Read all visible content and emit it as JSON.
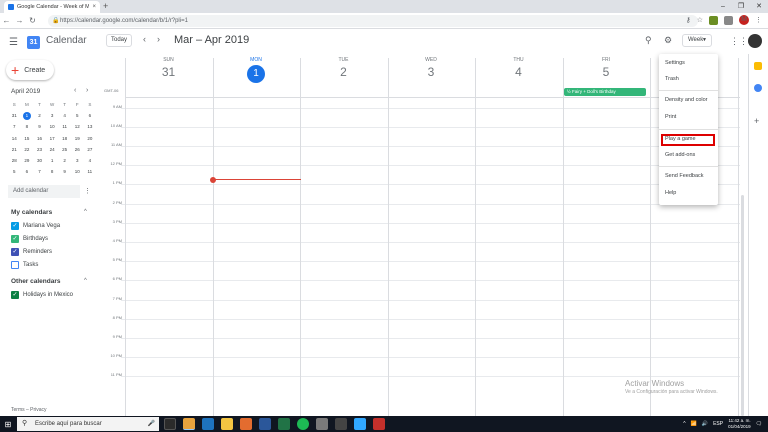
{
  "browser": {
    "tab_title": "Google Calendar - Week of Ma...",
    "tab_close": "×",
    "new_tab": "+",
    "url": "https://calendar.google.com/calendar/b/1/r?pli=1",
    "window_controls": [
      "–",
      "❐",
      "✕"
    ]
  },
  "header": {
    "app_name": "Calendar",
    "logo_number": "31",
    "today_label": "Today",
    "date_range": "Mar – Apr 2019",
    "view_label": "Week"
  },
  "sidebar": {
    "create_label": "Create",
    "mini_calendar": {
      "month_label": "April 2019",
      "dow": [
        "S",
        "M",
        "T",
        "W",
        "T",
        "F",
        "S"
      ],
      "weeks": [
        [
          "31",
          "1",
          "2",
          "3",
          "4",
          "5",
          "6"
        ],
        [
          "7",
          "8",
          "9",
          "10",
          "11",
          "12",
          "13"
        ],
        [
          "14",
          "15",
          "16",
          "17",
          "18",
          "19",
          "20"
        ],
        [
          "21",
          "22",
          "23",
          "24",
          "25",
          "26",
          "27"
        ],
        [
          "28",
          "29",
          "30",
          "1",
          "2",
          "3",
          "4"
        ],
        [
          "5",
          "6",
          "7",
          "8",
          "9",
          "10",
          "11"
        ]
      ],
      "today": "1"
    },
    "add_calendar_placeholder": "Add calendar",
    "my_calendars_title": "My calendars",
    "my_calendars": [
      {
        "label": "Mariana Vega",
        "color": "#039be5",
        "checked": true
      },
      {
        "label": "Birthdays",
        "color": "#33b679",
        "checked": true
      },
      {
        "label": "Reminders",
        "color": "#3f51b5",
        "checked": true
      },
      {
        "label": "Tasks",
        "color": "#4285f4",
        "checked": false
      }
    ],
    "other_calendars_title": "Other calendars",
    "other_calendars": [
      {
        "label": "Holidays in Mexico",
        "color": "#0b8043",
        "checked": true
      }
    ],
    "terms": "Terms – Privacy"
  },
  "week": {
    "days": [
      {
        "dow": "SUN",
        "num": "31",
        "today": false
      },
      {
        "dow": "MON",
        "num": "1",
        "today": true
      },
      {
        "dow": "TUE",
        "num": "2",
        "today": false
      },
      {
        "dow": "WED",
        "num": "3",
        "today": false
      },
      {
        "dow": "THU",
        "num": "4",
        "today": false
      },
      {
        "dow": "FRI",
        "num": "5",
        "today": false
      }
    ],
    "timezone": "GMT-06",
    "hours": [
      "9 AM",
      "10 AM",
      "11 AM",
      "12 PM",
      "1 PM",
      "2 PM",
      "3 PM",
      "4 PM",
      "5 PM",
      "6 PM",
      "7 PM",
      "8 PM",
      "9 PM",
      "10 PM",
      "11 PM"
    ],
    "event": {
      "title": "½ Fairy + Doll's Birthday",
      "color": "#33b679"
    }
  },
  "settings_menu": {
    "items": [
      "Settings",
      "Trash",
      "Density and color",
      "Print",
      "Play a game",
      "Get add-ons",
      "Send Feedback",
      "Help"
    ],
    "highlighted": "Play a game"
  },
  "watermark": {
    "line1": "Activar Windows",
    "line2": "Ve a Configuración para activar Windows."
  },
  "taskbar": {
    "search_placeholder": "Escribe aquí para buscar",
    "language": "ESP",
    "time": "11:42 a. m.",
    "date": "01/04/2019"
  }
}
